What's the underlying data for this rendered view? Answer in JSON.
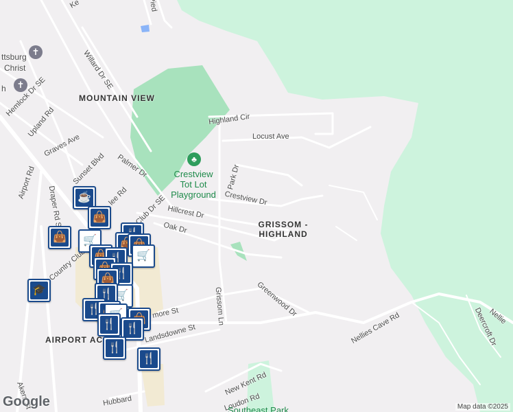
{
  "map": {
    "areas": [
      "MOUNTAIN VIEW",
      "GRISSOM - HIGHLAND",
      "AIRPORT AC"
    ],
    "streets": [
      "Highland Cir",
      "Locust Ave",
      "Park Dr",
      "Crestview Dr",
      "Hillcrest Dr",
      "Oak Dr",
      "Palmer Dr",
      "Club Dr SE",
      "Sunset Blvd",
      "Graves Ave",
      "Upland Rd",
      "Hemlock Dr SE",
      "Willard Dr SE",
      "Airport Rd",
      "Draper Rd SW",
      "Country Club",
      "Grissom Ln",
      "Greenwood Dr",
      "Nellies Cave Rd",
      "Deercroft Dr",
      "Landsdowne St",
      "more St",
      "New Kent Rd",
      "Loudon Rd",
      "Akers St",
      "Hubbard",
      "Pied",
      "Ke",
      "lee Rd",
      "Nellie"
    ],
    "places": {
      "park_name_line1": "Crestview",
      "park_name_line2": "Tot Lot",
      "park_name_line3": "Playground",
      "church_partial_1": "ttsburg",
      "church_partial_2": "Christ",
      "church_partial_3": "h",
      "southeast_park": "Southeast Park"
    },
    "icons": [
      "church-icon",
      "park-icon",
      "coffee-icon",
      "shopping-bag-icon",
      "shopping-cart-icon",
      "restaurant-icon",
      "school-icon"
    ],
    "colors": {
      "background": "#f1eff1",
      "forest": "#cdf3dd",
      "golf": "#a8e2bd",
      "pin_blue": "#1a4a8c",
      "park_text": "#1e8a4a"
    }
  },
  "footer": {
    "logo": "Google",
    "attribution": "Map data ©2025"
  }
}
